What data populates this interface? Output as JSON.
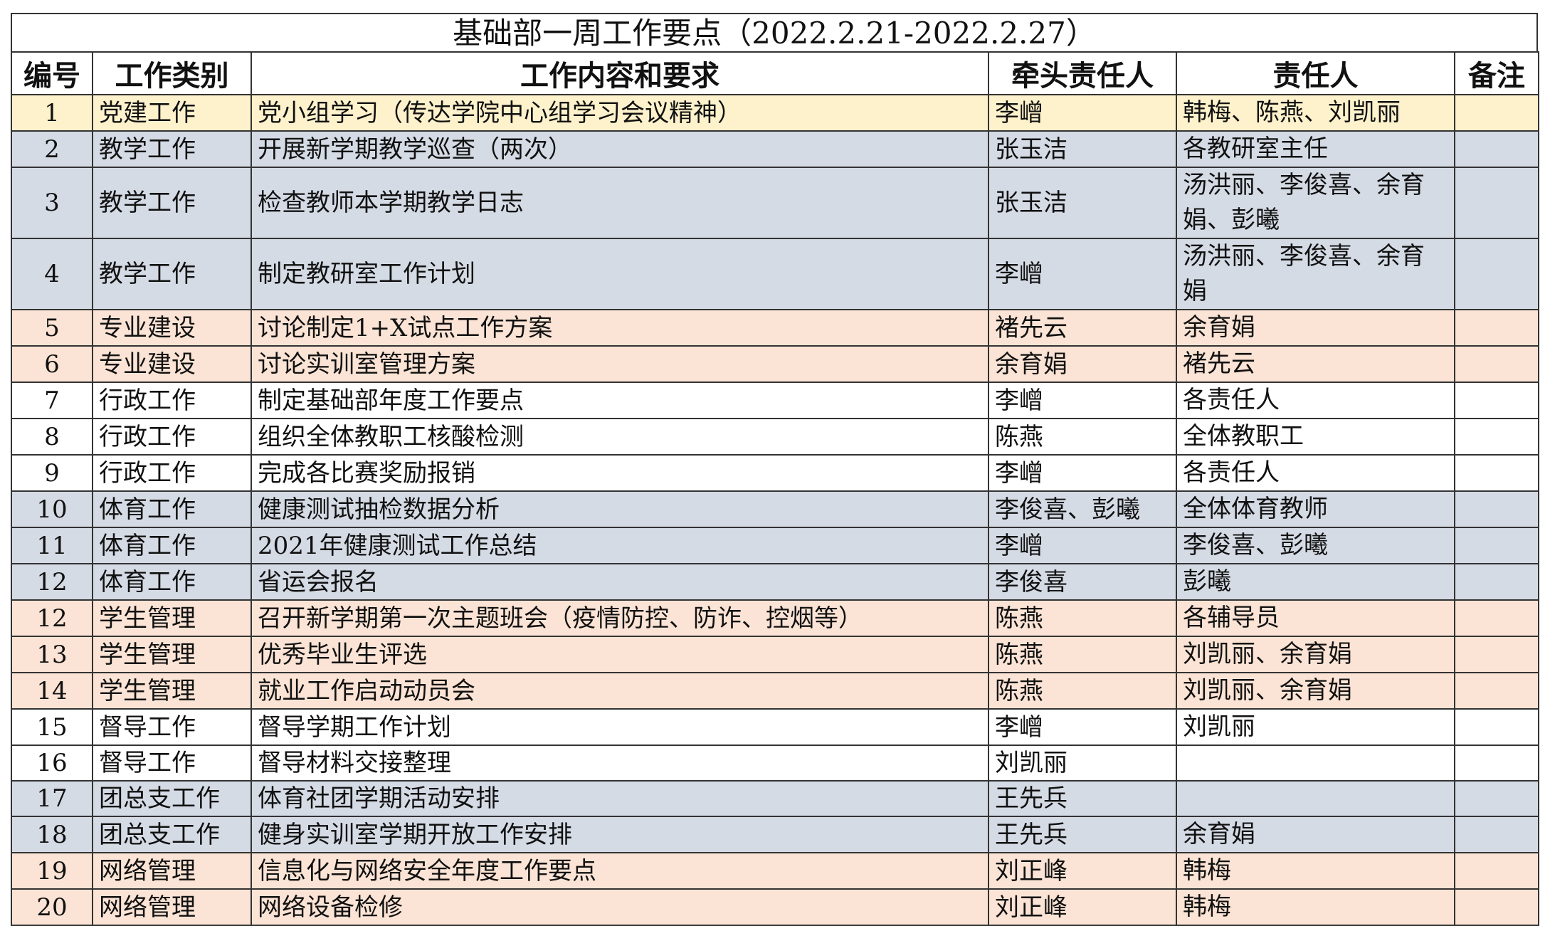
{
  "title": "基础部一周工作要点（2022.2.21-2022.2.27）",
  "columns": [
    "编号",
    "工作类别",
    "工作内容和要求",
    "牵头责任人",
    "责任人",
    "备注"
  ],
  "colors": {
    "yellow": "#fef2cc",
    "gray": "#d5dbe5",
    "pink": "#fbe4d5",
    "white": "#ffffff"
  },
  "rows": [
    {
      "no": "1",
      "type": "党建工作",
      "content": "党小组学习（传达学院中心组学习会议精神）",
      "lead": "李嶒",
      "resp": "韩梅、陈燕、刘凯丽",
      "note": "",
      "color": "yellow",
      "tall": false
    },
    {
      "no": "2",
      "type": "教学工作",
      "content": "开展新学期教学巡查（两次）",
      "lead": "张玉洁",
      "resp": "各教研室主任",
      "note": "",
      "color": "gray",
      "tall": false
    },
    {
      "no": "3",
      "type": "教学工作",
      "content": "检查教师本学期教学日志",
      "lead": "张玉洁",
      "resp": "汤洪丽、李俊喜、余育娟、彭曦",
      "note": "",
      "color": "gray",
      "tall": true
    },
    {
      "no": "4",
      "type": "教学工作",
      "content": "制定教研室工作计划",
      "lead": "李嶒",
      "resp": "汤洪丽、李俊喜、余育娟",
      "note": "",
      "color": "gray",
      "tall": true
    },
    {
      "no": "5",
      "type": "专业建设",
      "content": "讨论制定1+X试点工作方案",
      "lead": "褚先云",
      "resp": "余育娟",
      "note": "",
      "color": "pink",
      "tall": false
    },
    {
      "no": "6",
      "type": "专业建设",
      "content": "讨论实训室管理方案",
      "lead": "余育娟",
      "resp": "褚先云",
      "note": "",
      "color": "pink",
      "tall": false
    },
    {
      "no": "7",
      "type": "行政工作",
      "content": "制定基础部年度工作要点",
      "lead": "李嶒",
      "resp": "各责任人",
      "note": "",
      "color": "white",
      "tall": false
    },
    {
      "no": "8",
      "type": "行政工作",
      "content": "组织全体教职工核酸检测",
      "lead": "陈燕",
      "resp": "全体教职工",
      "note": "",
      "color": "white",
      "tall": false
    },
    {
      "no": "9",
      "type": "行政工作",
      "content": "完成各比赛奖励报销",
      "lead": "李嶒",
      "resp": "各责任人",
      "note": "",
      "color": "white",
      "tall": false
    },
    {
      "no": "10",
      "type": "体育工作",
      "content": "健康测试抽检数据分析",
      "lead": "李俊喜、彭曦",
      "resp": "全体体育教师",
      "note": "",
      "color": "gray",
      "tall": false
    },
    {
      "no": "11",
      "type": "体育工作",
      "content": "2021年健康测试工作总结",
      "lead": "李嶒",
      "resp": "李俊喜、彭曦",
      "note": "",
      "color": "gray",
      "tall": false
    },
    {
      "no": "12",
      "type": "体育工作",
      "content": "省运会报名",
      "lead": "李俊喜",
      "resp": "彭曦",
      "note": "",
      "color": "gray",
      "tall": false
    },
    {
      "no": "12",
      "type": "学生管理",
      "content": "召开新学期第一次主题班会（疫情防控、防诈、控烟等）",
      "lead": "陈燕",
      "resp": "各辅导员",
      "note": "",
      "color": "pink",
      "tall": false
    },
    {
      "no": "13",
      "type": "学生管理",
      "content": "优秀毕业生评选",
      "lead": "陈燕",
      "resp": "刘凯丽、余育娟",
      "note": "",
      "color": "pink",
      "tall": false
    },
    {
      "no": "14",
      "type": "学生管理",
      "content": "就业工作启动动员会",
      "lead": "陈燕",
      "resp": "刘凯丽、余育娟",
      "note": "",
      "color": "pink",
      "tall": false
    },
    {
      "no": "15",
      "type": "督导工作",
      "content": "督导学期工作计划",
      "lead": "李嶒",
      "resp": "刘凯丽",
      "note": "",
      "color": "white",
      "tall": false
    },
    {
      "no": "16",
      "type": "督导工作",
      "content": "督导材料交接整理",
      "lead": "刘凯丽",
      "resp": "",
      "note": "",
      "color": "white",
      "tall": false
    },
    {
      "no": "17",
      "type": "团总支工作",
      "content": "体育社团学期活动安排",
      "lead": "王先兵",
      "resp": "",
      "note": "",
      "color": "gray",
      "tall": false
    },
    {
      "no": "18",
      "type": "团总支工作",
      "content": "健身实训室学期开放工作安排",
      "lead": "王先兵",
      "resp": "余育娟",
      "note": "",
      "color": "gray",
      "tall": false
    },
    {
      "no": "19",
      "type": "网络管理",
      "content": "信息化与网络安全年度工作要点",
      "lead": "刘正峰",
      "resp": "韩梅",
      "note": "",
      "color": "pink",
      "tall": false
    },
    {
      "no": "20",
      "type": "网络管理",
      "content": "网络设备检修",
      "lead": "刘正峰",
      "resp": "韩梅",
      "note": "",
      "color": "pink",
      "tall": false
    }
  ]
}
